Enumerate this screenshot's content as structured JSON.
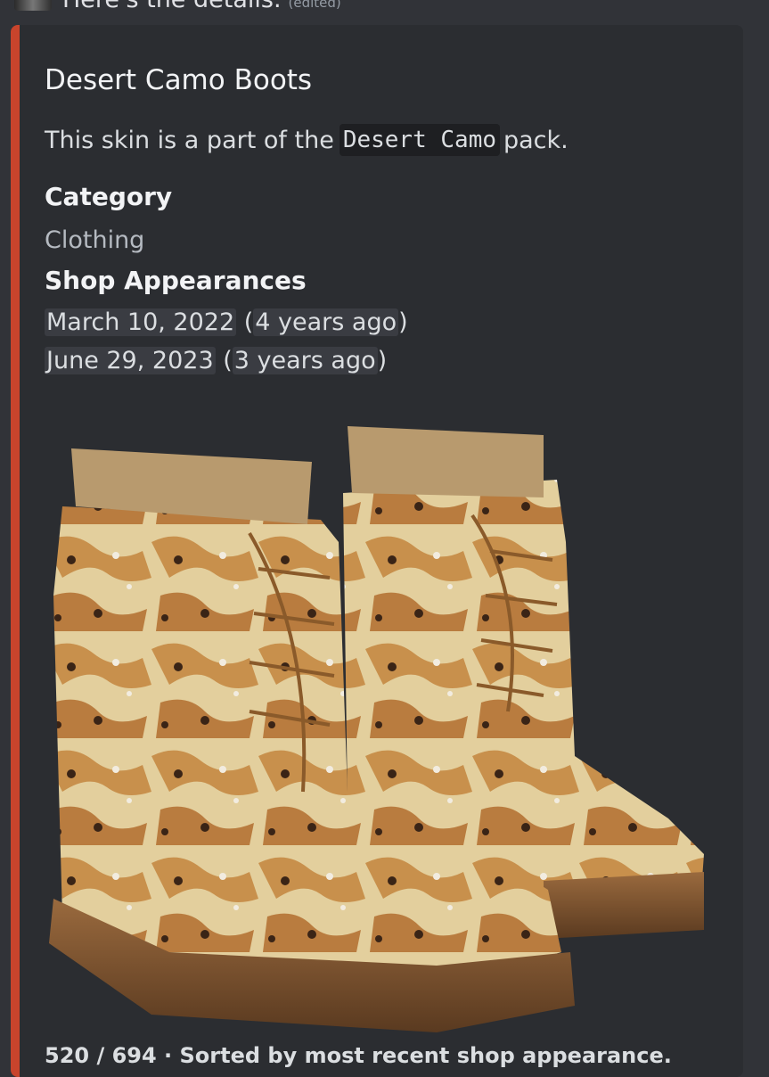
{
  "message": {
    "partial_text": "Here's the details.",
    "edited_label": "(edited)"
  },
  "embed": {
    "accent_color": "#c8442c",
    "title": "Desert Camo Boots",
    "description_prefix": "This skin is a part of the",
    "pack_name": "Desert Camo",
    "description_suffix": "pack.",
    "fields": {
      "category_name": "Category",
      "category_value": "Clothing",
      "shop_name": "Shop Appearances"
    },
    "appearances": [
      {
        "date": "March 10, 2022",
        "relative": "4 years ago"
      },
      {
        "date": "June 29, 2023",
        "relative": "3 years ago"
      }
    ],
    "image_alt": "desert camo boots",
    "footer": "520 / 694 · Sorted by most recent shop appearance."
  }
}
